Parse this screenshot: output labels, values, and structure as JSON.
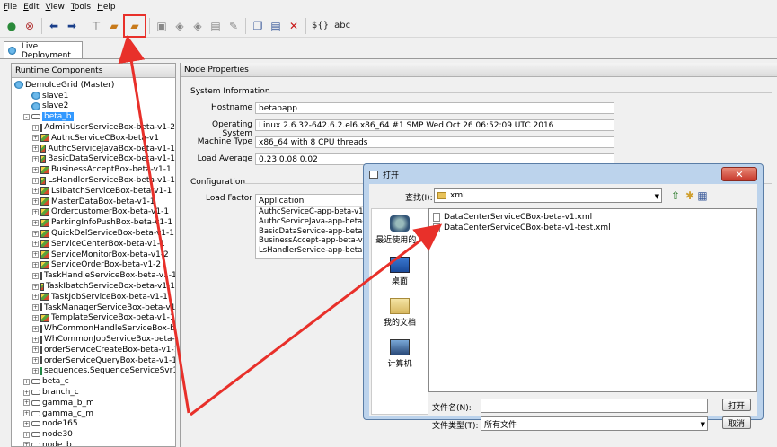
{
  "menu": [
    "File",
    "Edit",
    "View",
    "Tools",
    "Help"
  ],
  "toolbar": {
    "text_buttons": [
      "${}",
      "abc"
    ],
    "highlight_color": "#e8302a"
  },
  "tab": {
    "label": "Live Deployment"
  },
  "left_panel": {
    "title": "Runtime Components",
    "tree": [
      {
        "label": "DemoIceGrid (Master)",
        "level": 0,
        "icon": "grid-icon",
        "expander": ""
      },
      {
        "label": "slave1",
        "level": 1,
        "icon": "slave",
        "expander": ""
      },
      {
        "label": "slave2",
        "level": 1,
        "icon": "slave",
        "expander": ""
      },
      {
        "label": "beta_b",
        "level": 1,
        "icon": "node",
        "expander": "-",
        "selected": true
      },
      {
        "label": "AdminUserServiceBox-beta-v1-2",
        "level": 2,
        "icon": "box",
        "expander": "+"
      },
      {
        "label": "AuthcServiceCBox-beta-v1",
        "level": 2,
        "icon": "box",
        "expander": "+"
      },
      {
        "label": "AuthcServiceJavaBox-beta-v1-1",
        "level": 2,
        "icon": "box",
        "expander": "+"
      },
      {
        "label": "BasicDataServiceBox-beta-v1-1",
        "level": 2,
        "icon": "box",
        "expander": "+"
      },
      {
        "label": "BusinessAcceptBox-beta-v1-1",
        "level": 2,
        "icon": "box",
        "expander": "+"
      },
      {
        "label": "LsHandlerServiceBox-beta-v1-1",
        "level": 2,
        "icon": "box",
        "expander": "+"
      },
      {
        "label": "LsIbatchServiceBox-beta-v1-1",
        "level": 2,
        "icon": "box",
        "expander": "+"
      },
      {
        "label": "MasterDataBox-beta-v1-1",
        "level": 2,
        "icon": "box",
        "expander": "+"
      },
      {
        "label": "OrdercustomerBox-beta-v1-1",
        "level": 2,
        "icon": "box",
        "expander": "+"
      },
      {
        "label": "ParkingInfoPushBox-beta-v1-1",
        "level": 2,
        "icon": "box",
        "expander": "+"
      },
      {
        "label": "QuickDelServiceBox-beta-v1-1",
        "level": 2,
        "icon": "box",
        "expander": "+"
      },
      {
        "label": "ServiceCenterBox-beta-v1-1",
        "level": 2,
        "icon": "box",
        "expander": "+"
      },
      {
        "label": "ServiceMonitorBox-beta-v1-2",
        "level": 2,
        "icon": "box",
        "expander": "+"
      },
      {
        "label": "ServiceOrderBox-beta-v1-2",
        "level": 2,
        "icon": "box",
        "expander": "+"
      },
      {
        "label": "TaskHandleServiceBox-beta-v1-1",
        "level": 2,
        "icon": "box",
        "expander": "+"
      },
      {
        "label": "TaskIbatchServiceBox-beta-v1-1",
        "level": 2,
        "icon": "box",
        "expander": "+"
      },
      {
        "label": "TaskJobServiceBox-beta-v1-1",
        "level": 2,
        "icon": "box",
        "expander": "+"
      },
      {
        "label": "TaskManagerServiceBox-beta-v1-1",
        "level": 2,
        "icon": "box",
        "expander": "+"
      },
      {
        "label": "TemplateServiceBox-beta-v1-1",
        "level": 2,
        "icon": "box",
        "expander": "+"
      },
      {
        "label": "WhCommonHandleServiceBox-beta-",
        "level": 2,
        "icon": "box",
        "expander": "+"
      },
      {
        "label": "WhCommonJobServiceBox-beta-v1-",
        "level": 2,
        "icon": "box",
        "expander": "+"
      },
      {
        "label": "orderServiceCreateBox-beta-v1-1",
        "level": 2,
        "icon": "box",
        "expander": "+"
      },
      {
        "label": "orderServiceQueryBox-beta-v1-1",
        "level": 2,
        "icon": "box",
        "expander": "+"
      },
      {
        "label": "sequences.SequenceServiceSvr1",
        "level": 2,
        "icon": "seq",
        "expander": "+"
      },
      {
        "label": "beta_c",
        "level": 1,
        "icon": "node",
        "expander": "+"
      },
      {
        "label": "branch_c",
        "level": 1,
        "icon": "node",
        "expander": "+"
      },
      {
        "label": "gamma_b_m",
        "level": 1,
        "icon": "node",
        "expander": "+"
      },
      {
        "label": "gamma_c_m",
        "level": 1,
        "icon": "node",
        "expander": "+"
      },
      {
        "label": "node165",
        "level": 1,
        "icon": "node",
        "expander": "+"
      },
      {
        "label": "node30",
        "level": 1,
        "icon": "node",
        "expander": "+"
      },
      {
        "label": "node_b",
        "level": 1,
        "icon": "node",
        "expander": "+"
      }
    ]
  },
  "node_properties": {
    "title": "Node Properties",
    "system_info_label": "System Information",
    "hostname_label": "Hostname",
    "hostname": "betabapp",
    "os_label": "Operating System",
    "os": "Linux 2.6.32-642.6.2.el6.x86_64 #1 SMP Wed Oct 26 06:52:09 UTC 2016",
    "machine_type_label": "Machine Type",
    "machine_type": "x86_64 with 8 CPU threads",
    "load_avg_label": "Load Average",
    "load_avg": "0.23 0.08 0.02",
    "configuration_label": "Configuration",
    "load_factor_label": "Load Factor",
    "application_header": "Application",
    "applications": [
      "AuthcServiceC-app-beta-v1",
      "AuthcServiceJava-app-beta-v1",
      "BasicDataService-app-beta-v1",
      "BusinessAccept-app-beta-v1",
      "LsHandlerService-app-beta-v1"
    ]
  },
  "open_dialog": {
    "title": "打开",
    "look_in_label": "查找(I):",
    "look_in_value": "xml",
    "places": [
      "最近使用的...",
      "桌面",
      "我的文档",
      "计算机"
    ],
    "files": [
      "DataCenterServiceCBox-beta-v1.xml",
      "DataCenterServiceCBox-beta-v1-test.xml"
    ],
    "filename_label": "文件名(N):",
    "filename_value": "",
    "filetype_label": "文件类型(T):",
    "filetype_value": "所有文件",
    "open_button": "打开",
    "cancel_button": "取消"
  },
  "annotation_color": "#e8302a"
}
